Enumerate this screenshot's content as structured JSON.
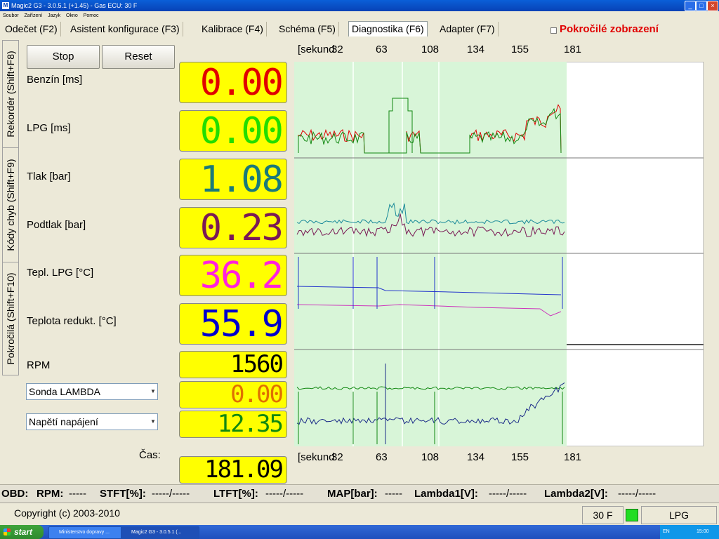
{
  "window": {
    "title": "Magic2 G3 - 3.0.5.1 (+1.45) - Gas ECU: 30 F",
    "icon_text": "M",
    "controls": [
      "_",
      "□",
      "×"
    ]
  },
  "menu": [
    "Soubor",
    "Zařízení",
    "Jazyk",
    "Okno",
    "Pomoc"
  ],
  "tabs": [
    {
      "label": "Odečet (F2)"
    },
    {
      "label": "Asistent konfigurace (F3)"
    },
    {
      "label": "Kalibrace (F4)"
    },
    {
      "label": "Schéma (F5)"
    },
    {
      "label": "Diagnostika (F6)",
      "active": true
    },
    {
      "label": "Adapter (F7)"
    }
  ],
  "advanced_view": {
    "label": "Pokročilé zobrazení",
    "checked": false
  },
  "side_tabs": [
    "Rekordér (Shift+F8)",
    "Kódy chyb (Shift+F9)",
    "Pokročilá (Shift+F10)"
  ],
  "buttons": {
    "stop": "Stop",
    "reset": "Reset"
  },
  "readings": [
    {
      "label": "Benzín [ms]",
      "value": "0.00",
      "color": "#e00000"
    },
    {
      "label": "LPG [ms]",
      "value": "0.00",
      "color": "#22dd00"
    },
    {
      "label": "Tlak [bar]",
      "value": "1.08",
      "color": "#1a7a7a"
    },
    {
      "label": "Podtlak [bar]",
      "value": "0.23",
      "color": "#7a1a55"
    },
    {
      "label": "Tepl. LPG [°C]",
      "value": "36.2",
      "color": "#ff22dd"
    },
    {
      "label": "Teplota redukt. [°C]",
      "value": "55.9",
      "color": "#0000cc"
    }
  ],
  "extra": {
    "rpm_label": "RPM",
    "rpm_value": "1560",
    "rpm_color": "#000000",
    "select1": "Sonda LAMBDA",
    "select1_value": "0.00",
    "select1_color": "#e07000",
    "select2": "Napětí napájení",
    "select2_value": "12.35",
    "select2_color": "#118811",
    "time_label": "Čas:",
    "time_value": "181.09",
    "time_color": "#000000"
  },
  "chart_data": {
    "type": "line",
    "x_axis_label": "[sekund",
    "x_ticks": [
      32,
      63,
      108,
      134,
      155,
      181
    ],
    "panels": [
      {
        "series": [
          {
            "name": "Benzín [ms]",
            "color": "#e00000"
          },
          {
            "name": "LPG [ms]",
            "color": "#118811"
          }
        ]
      },
      {
        "series": [
          {
            "name": "Tlak [bar]",
            "color": "#1a8a9a"
          },
          {
            "name": "Podtlak [bar]",
            "color": "#7a1a55"
          }
        ]
      },
      {
        "series": [
          {
            "name": "Tepl. LPG [°C]",
            "color": "#cc33bb"
          },
          {
            "name": "Teplota redukt. [°C]",
            "color": "#2233cc"
          }
        ]
      },
      {
        "series": [
          {
            "name": "Sonda LAMBDA",
            "color": "#e07000"
          },
          {
            "name": "Napětí napájení",
            "color": "#118811"
          },
          {
            "name": "RPM",
            "color": "#1a2a88"
          }
        ]
      }
    ],
    "background_color": "#d8f5d8"
  },
  "status": {
    "items": [
      {
        "label": "OBD:",
        "value": ""
      },
      {
        "label": "RPM:",
        "value": "-----"
      },
      {
        "label": "STFT[%]:",
        "value": "-----/-----"
      },
      {
        "label": "LTFT[%]:",
        "value": "-----/-----"
      },
      {
        "label": "MAP[bar]:",
        "value": "-----"
      },
      {
        "label": "Lambda1[V]:",
        "value": "-----/-----"
      },
      {
        "label": "Lambda2[V]:",
        "value": "-----/-----"
      }
    ],
    "copyright": "Copyright (c) 2003-2010",
    "ecu": "30 F",
    "fuel": "LPG",
    "fuel_led_color": "#22dd22"
  },
  "taskbar": {
    "start": "start",
    "items": [
      "Ministerstvo dopravy ...",
      "Magic2 G3 - 3.0.5.1 (..."
    ],
    "lang": "EN",
    "clock": "15:00"
  }
}
